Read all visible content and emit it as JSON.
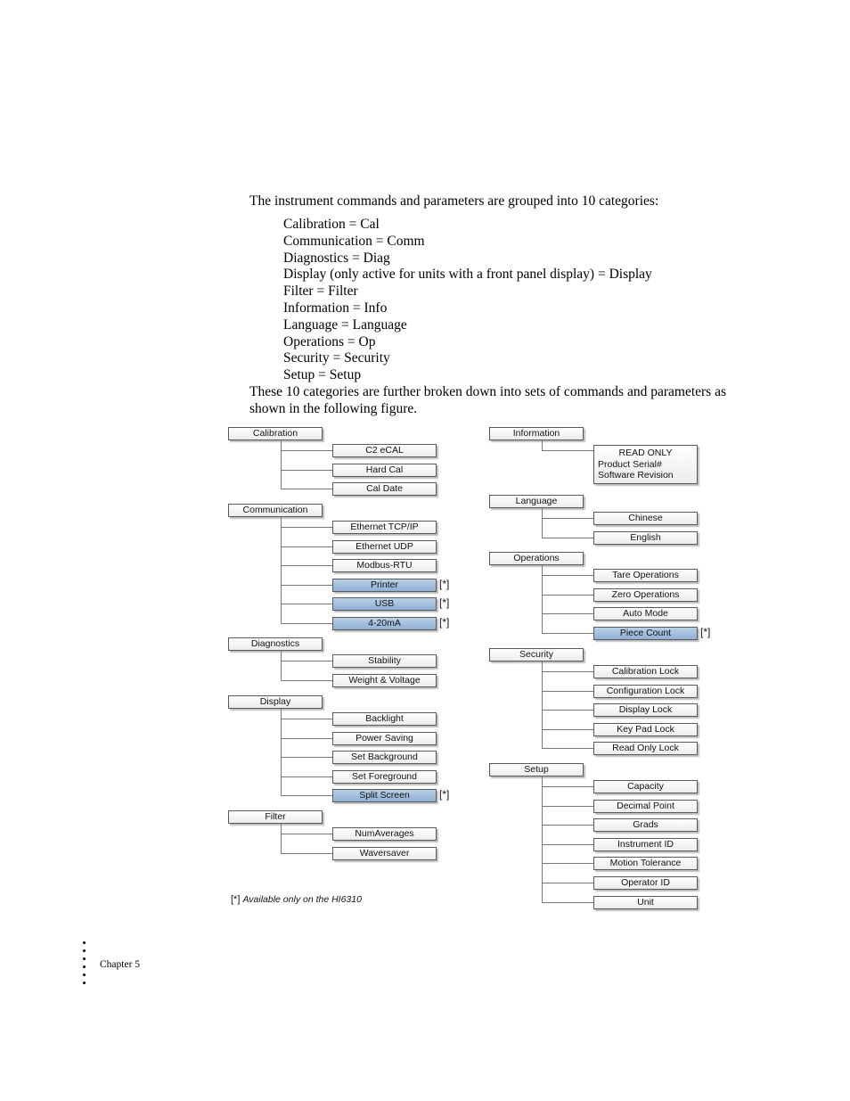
{
  "intro": "The instrument commands and parameters are grouped into 10 categories:",
  "categories_list": [
    "Calibration = Cal",
    "Communication = Comm",
    "Diagnostics = Diag",
    "Display (only active for units with a front panel display) = Display",
    "Filter = Filter",
    "Information = Info",
    "Language = Language",
    "Operations = Op",
    "Security = Security",
    "Setup = Setup"
  ],
  "outro": "These 10 categories are further broken down into sets of commands and parameters as shown in the following figure.",
  "diagram": {
    "highlight_color": "#9fbddf",
    "available_marker": "[*]",
    "left_column": [
      {
        "label": "Calibration",
        "children": [
          {
            "label": "C2 eCAL",
            "hl": false
          },
          {
            "label": "Hard Cal",
            "hl": false
          },
          {
            "label": "Cal Date",
            "hl": false
          }
        ]
      },
      {
        "label": "Communication",
        "children": [
          {
            "label": "Ethernet TCP/IP",
            "hl": false
          },
          {
            "label": "Ethernet UDP",
            "hl": false
          },
          {
            "label": "Modbus-RTU",
            "hl": false
          },
          {
            "label": "Printer",
            "hl": true
          },
          {
            "label": "USB",
            "hl": true
          },
          {
            "label": "4-20mA",
            "hl": true
          }
        ]
      },
      {
        "label": "Diagnostics",
        "children": [
          {
            "label": "Stability",
            "hl": false
          },
          {
            "label": "Weight & Voltage",
            "hl": false
          }
        ]
      },
      {
        "label": "Display",
        "children": [
          {
            "label": "Backlight",
            "hl": false
          },
          {
            "label": "Power Saving",
            "hl": false
          },
          {
            "label": "Set Background",
            "hl": false
          },
          {
            "label": "Set Foreground",
            "hl": false
          },
          {
            "label": "Split Screen",
            "hl": true
          }
        ]
      },
      {
        "label": "Filter",
        "children": [
          {
            "label": "NumAverages",
            "hl": false
          },
          {
            "label": "Waversaver",
            "hl": false
          }
        ]
      }
    ],
    "right_column": [
      {
        "label": "Information",
        "info": {
          "title": "READ ONLY",
          "lines": [
            "Product Serial#",
            "Software Revision"
          ]
        },
        "children": []
      },
      {
        "label": "Language",
        "children": [
          {
            "label": "Chinese",
            "hl": false
          },
          {
            "label": "English",
            "hl": false
          }
        ]
      },
      {
        "label": "Operations",
        "children": [
          {
            "label": "Tare Operations",
            "hl": false
          },
          {
            "label": "Zero Operations",
            "hl": false
          },
          {
            "label": "Auto Mode",
            "hl": false
          },
          {
            "label": "Piece Count",
            "hl": true
          }
        ]
      },
      {
        "label": "Security",
        "children": [
          {
            "label": "Calibration Lock",
            "hl": false
          },
          {
            "label": "Configuration Lock",
            "hl": false
          },
          {
            "label": "Display Lock",
            "hl": false
          },
          {
            "label": "Key Pad Lock",
            "hl": false
          },
          {
            "label": "Read Only Lock",
            "hl": false
          }
        ]
      },
      {
        "label": "Setup",
        "children": [
          {
            "label": "Capacity",
            "hl": false
          },
          {
            "label": "Decimal Point",
            "hl": false
          },
          {
            "label": "Grads",
            "hl": false
          },
          {
            "label": "Instrument ID",
            "hl": false
          },
          {
            "label": "Motion Tolerance",
            "hl": false
          },
          {
            "label": "Operator ID",
            "hl": false
          },
          {
            "label": "Unit",
            "hl": false
          }
        ]
      }
    ],
    "footnote": {
      "marker": "[*]",
      "text": "Available only on the HI6310"
    }
  },
  "footer": {
    "chapter": "Chapter 5"
  }
}
